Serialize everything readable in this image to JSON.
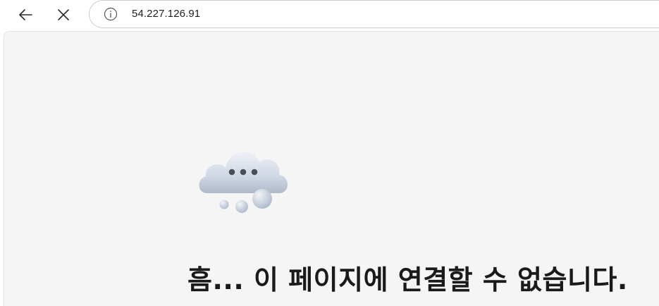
{
  "browser": {
    "url": "54.227.126.91",
    "back_icon": "arrow-left-icon",
    "stop_icon": "close-icon",
    "site_info_icon": "info-icon"
  },
  "page": {
    "illustration": "cloud-thinking-icon",
    "heading": "흠... 이 페이지에 연결할 수 없습니다."
  },
  "colors": {
    "page_background": "#f5f5f5",
    "toolbar_background": "#ffffff",
    "heading_text": "#1a1a1a"
  }
}
